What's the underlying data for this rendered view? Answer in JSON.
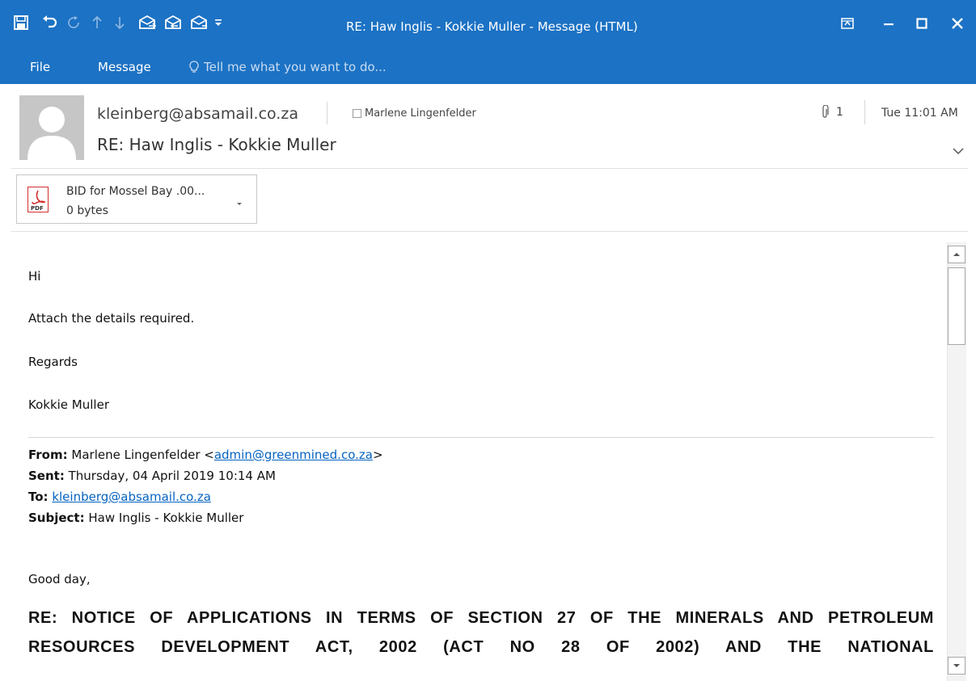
{
  "window": {
    "title": "RE: Haw Inglis - Kokkie Muller - Message (HTML)"
  },
  "quick_access": {
    "icons": [
      "save-icon",
      "undo-icon",
      "redo-icon",
      "previous-item-icon",
      "next-item-icon",
      "reply-icon",
      "reply-all-icon",
      "forward-icon",
      "customize-qat-icon"
    ]
  },
  "window_controls": {
    "icons": [
      "ribbon-display-options-icon",
      "minimize-icon",
      "maximize-icon",
      "close-icon"
    ]
  },
  "ribbon": {
    "tabs": [
      {
        "label": "File"
      },
      {
        "label": "Message"
      }
    ],
    "tell_me": "Tell me what you want to do..."
  },
  "message": {
    "sender": "kleinberg@absamail.co.za",
    "recipient": "Marlene Lingenfelder",
    "subject": "RE: Haw Inglis - Kokkie Muller",
    "attachment_count": "1",
    "date": "Tue 11:01 AM"
  },
  "attachment": {
    "name": "BID for Mossel Bay .00...",
    "size": "0 bytes",
    "icon_label": "PDF"
  },
  "body": {
    "greeting": "Hi",
    "line1": "Attach the details required.",
    "regards": "Regards",
    "signature": "Kokkie Muller",
    "quoted": {
      "from_label": "From:",
      "from_name": "Marlene Lingenfelder <",
      "from_email": "admin@greenmined.co.za",
      "from_close": ">",
      "sent_label": "Sent:",
      "sent_value": "Thursday, 04 April 2019 10:14 AM",
      "to_label": "To:",
      "to_value": "kleinberg@absamail.co.za",
      "subject_label": "Subject:",
      "subject_value": "Haw Inglis - Kokkie Muller"
    },
    "good_day": "Good day,",
    "notice_line1": "RE: NOTICE OF APPLICATIONS IN TERMS OF SECTION 27 OF THE MINERALS AND PETROLEUM",
    "notice_line2": "RESOURCES DEVELOPMENT ACT, 2002 (ACT NO 28 OF 2002) AND THE NATIONAL"
  },
  "colors": {
    "titlebar": "#1c72c4",
    "link": "#0563c1",
    "pdf_red": "#d32f2f"
  }
}
